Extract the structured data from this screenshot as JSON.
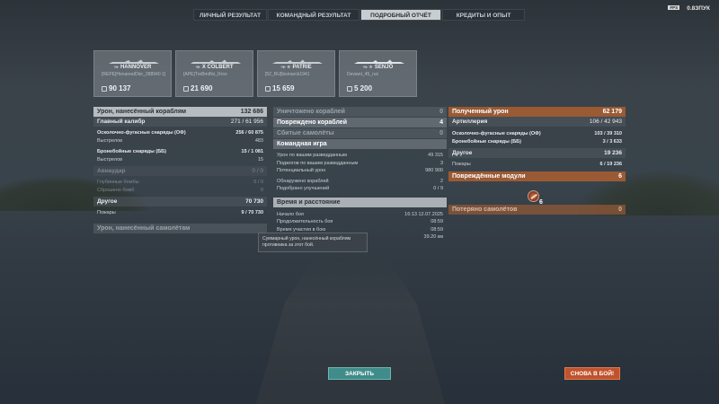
{
  "tabs": [
    {
      "label": "ЛИЧНЫЙ РЕЗУЛЬТАТ",
      "active": false
    },
    {
      "label": "КОМАНДНЫЙ РЕЗУЛЬТАТ",
      "active": false
    },
    {
      "label": "ПОДРОБНЫЙ ОТЧЁТ",
      "active": true
    },
    {
      "label": "КРЕДИТЫ И ОПЫТ",
      "active": false
    }
  ],
  "top_right": {
    "fps_badge": "FPS",
    "version": "0.8ЗПУК"
  },
  "ships": [
    {
      "name": "HANNOVER",
      "nation": "«▸",
      "player": "[REPE]HenareaIDlor_288940 1]",
      "damage": "90 137"
    },
    {
      "name": "X COLBERT",
      "nation": "«▸",
      "player": "[APE]TreBmtNo_Rros",
      "damage": "21 690"
    },
    {
      "name": "PATRIE",
      "nation": "«▸ ★",
      "player": "[52_RU]bismarck1941",
      "damage": "15 659"
    },
    {
      "name": "SENJŌ",
      "nation": "«▸ ★",
      "player": "Deviant_45_rus",
      "damage": "5 200"
    }
  ],
  "left_panel": {
    "header": {
      "label": "Урон, нанесённый кораблям",
      "value": "132 686"
    },
    "main_caliber": {
      "label": "Главный калибр",
      "value": "271 / 61 956"
    },
    "he": {
      "label": "Осколочно-фугасные снаряды (ОФ)",
      "value": "256 / 60 875"
    },
    "he_shots": {
      "label": "Выстрелов",
      "value": "483"
    },
    "ap": {
      "label": "Бронебойные снаряды (ББ)",
      "value": "15 / 1 081"
    },
    "ap_shots": {
      "label": "Выстрелов",
      "value": "15"
    },
    "aviation": {
      "label": "Авиаудар",
      "value": "0 / 0"
    },
    "depth_charges": {
      "label": "Глубинные бомбы",
      "value": "0 / 0"
    },
    "bombs_dropped": {
      "label": "Сброшено бомб",
      "value": "0"
    },
    "other": {
      "label": "Другое",
      "value": "70 730"
    },
    "fires": {
      "label": "Пожары",
      "value": "9 / 70 730"
    },
    "aircraft_damage": {
      "label": "Урон, нанесённый самолётам",
      "value": ""
    }
  },
  "middle_panel": {
    "destroyed": {
      "label": "Уничтожено кораблей",
      "value": "0"
    },
    "damaged": {
      "label": "Повреждено кораблей",
      "value": "4"
    },
    "planes_shot": {
      "label": "Сбитые самолёты",
      "value": "0"
    },
    "team_game": {
      "label": "Командная игра"
    },
    "spot_damage": {
      "label": "Урон по вашим разведданным",
      "value": "49 315"
    },
    "spot_fires": {
      "label": "Поджогов по вашим разведданным",
      "value": "3"
    },
    "potential": {
      "label": "Потенциальный урон",
      "value": "980 900"
    },
    "detected": {
      "label": "Обнаружено кораблей",
      "value": "2"
    },
    "upgrades": {
      "label": "Подобрано улучшений",
      "value": "0 / 9"
    },
    "time_dist": {
      "label": "Время и расстояние"
    },
    "battle_start": {
      "label": "Начало боя",
      "value": "16:13  12.07.2025"
    },
    "duration": {
      "label": "Продолжительность боя",
      "value": "08:59"
    },
    "participation": {
      "label": "Время участия в бою",
      "value": "08:59"
    },
    "distance": {
      "label": "",
      "value": "39.20 км"
    }
  },
  "tooltip": {
    "text": "Суммарный урон, нанесённый кораблям противника за этот бой."
  },
  "right_panel": {
    "received": {
      "label": "Полученный урон",
      "value": "62 179"
    },
    "artillery": {
      "label": "Артиллерия",
      "value": "106 / 42 943"
    },
    "he": {
      "label": "Осколочно-фугасные снаряды (ОФ)",
      "value": "103 / 39 310"
    },
    "ap": {
      "label": "Бронебойные снаряды (ББ)",
      "value": "3 / 3 633"
    },
    "other": {
      "label": "Другое",
      "value": "19 236"
    },
    "fires": {
      "label": "Пожары",
      "value": "6 / 19 236"
    },
    "modules": {
      "label": "Повреждённые модули",
      "value": "6",
      "icon_count": "6"
    },
    "planes_lost": {
      "label": "Потеряно самолётов",
      "value": "0"
    }
  },
  "buttons": {
    "close": "ЗАКРЫТЬ",
    "battle": "СНОВА В БОЙ!"
  },
  "colors": {
    "accent_orange": "#9a5a34",
    "close_button": "#3f8c8a",
    "battle_button": "#c0532d"
  }
}
